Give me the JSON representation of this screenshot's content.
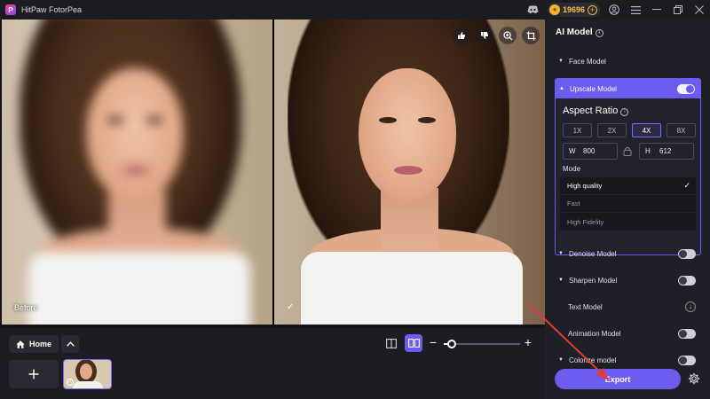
{
  "titlebar": {
    "app_title": "HitPaw FotorPea",
    "app_logo": "P",
    "coins": "19696",
    "icons": [
      "discord-icon",
      "coin-icon",
      "coin-plus-icon",
      "account-icon",
      "menu-icon",
      "minimize-icon",
      "maximize-icon",
      "close-icon"
    ]
  },
  "compare": {
    "before_label": "Before",
    "after_check": "✓",
    "tools": [
      "thumbs-up-icon",
      "thumbs-down-icon",
      "zoom-icon",
      "crop-icon"
    ]
  },
  "bottombar": {
    "home_label": "Home",
    "zoom_level": 0.1
  },
  "panel": {
    "title": "AI Model",
    "face_model": "Face Model",
    "upscale_model": "Upscale Model",
    "upscale_enabled": true,
    "aspect_ratio_title": "Aspect Ratio",
    "scales": [
      "1X",
      "2X",
      "4X",
      "8X"
    ],
    "selected_scale": "4X",
    "width_label": "W",
    "width_value": "800",
    "height_label": "H",
    "height_value": "612",
    "mode_title": "Mode",
    "modes": [
      "High quality",
      "Fast",
      "High Fidelity"
    ],
    "selected_mode": "High quality",
    "denoise_model": "Denoise Model",
    "sharpen_model": "Sharpen Model",
    "text_model": "Text Model",
    "animation_model": "Animation Model",
    "colorize_model": "Colorize model",
    "export_label": "Export"
  },
  "colors": {
    "accent": "#6c5cf0",
    "panel_bg": "#1f1f27",
    "arrow": "#e53935"
  }
}
